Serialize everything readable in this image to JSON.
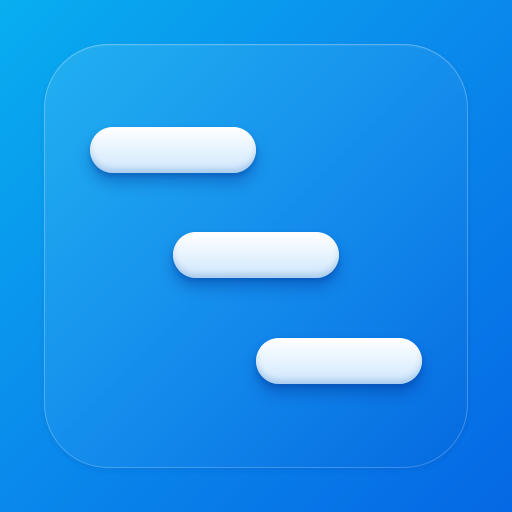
{
  "icon": {
    "background_gradient": [
      "#08aef0",
      "#0a8cec",
      "#0568e4"
    ],
    "bar_color": "#ffffff",
    "bar_count": 3
  }
}
